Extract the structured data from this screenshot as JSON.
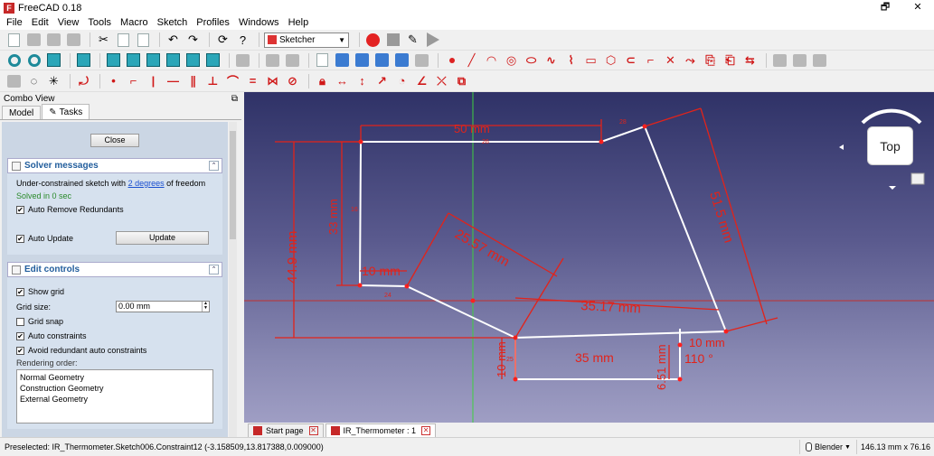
{
  "window": {
    "title": "FreeCAD 0.18",
    "buttons": {
      "restore": "🗗",
      "close": "✕"
    }
  },
  "menu": [
    "File",
    "Edit",
    "View",
    "Tools",
    "Macro",
    "Sketch",
    "Profiles",
    "Windows",
    "Help"
  ],
  "toolbar": {
    "workbench": "Sketcher"
  },
  "combo_view": {
    "title": "Combo View",
    "tabs": [
      "Model",
      "Tasks"
    ],
    "close_label": "Close",
    "solver": {
      "title": "Solver messages",
      "message_pre": "Under-constrained sketch with ",
      "message_link": "2 degrees",
      "message_post": " of freedom",
      "solved": "Solved in 0 sec",
      "auto_remove": "Auto Remove Redundants",
      "auto_update": "Auto Update",
      "update_label": "Update"
    },
    "edit_controls": {
      "title": "Edit controls",
      "show_grid": "Show grid",
      "grid_size_label": "Grid size:",
      "grid_size_value": "0.00 mm",
      "grid_snap": "Grid snap",
      "auto_constraints": "Auto constraints",
      "avoid_redundant": "Avoid redundant auto constraints",
      "rendering_order_label": "Rendering order:",
      "rendering_order": [
        "Normal Geometry",
        "Construction Geometry",
        "External Geometry"
      ]
    }
  },
  "view3d": {
    "navcube": "Top",
    "dimensions": {
      "top_width": "50 mm",
      "left_height": "33 mm",
      "outer_height": "44.9 mm",
      "slant_left": "25.57 mm",
      "right_slant": "51.5 mm",
      "small_left": "10 mm",
      "mid_width": "35.17 mm",
      "bottom_width": "35 mm",
      "bottom_left_height": "10 mm",
      "bottom_right_height": "6.51 mm",
      "small_right": "10 mm",
      "angle": "110 °",
      "sub_a": "28",
      "sub_b": "16",
      "sub_c": "24",
      "sub_d": "26",
      "sub_e": "25"
    }
  },
  "doc_tabs": [
    "Start page",
    "IR_Thermometer : 1"
  ],
  "status": {
    "preselected": "Preselected: IR_Thermometer.Sketch006.Constraint12 (-3.158509,13.817388,0.009000)",
    "nav_style": "Blender",
    "dimensions": "146.13 mm x 76.16"
  }
}
